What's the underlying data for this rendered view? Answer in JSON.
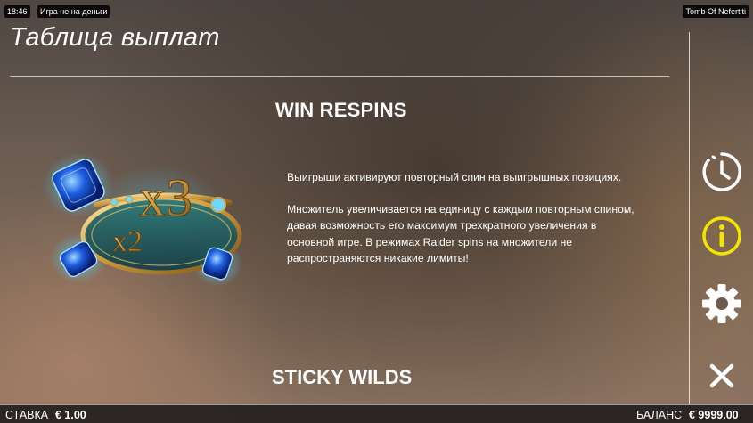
{
  "status_bar": {
    "time": "18:46",
    "mode": "Игра не на деньги",
    "game_title": "Tomb Of Nefertiti"
  },
  "paytable": {
    "title": "Таблица выплат",
    "section": {
      "heading": "WIN RESPINS",
      "symbol_icon": "sapphire-multiplier-icon",
      "multiplier_labels": [
        "x2",
        "x3"
      ],
      "paragraphs": [
        "Выигрыши активируют повторный спин на выигрышных позициях.",
        "Множитель увеличивается на единицу с каждым повторным спином, давая возможность его максимум трехкратного увеличения в основной игре. В режимах Raider spins на множители не распространяются никакие лимиты!"
      ]
    },
    "next_section_heading": "STICKY WILDS"
  },
  "menu": {
    "history_icon": "history-clock-icon",
    "info_icon": "info-icon",
    "settings_icon": "gear-icon",
    "close_icon": "close-icon",
    "info_color": "#f5e400"
  },
  "bottom_bar": {
    "bet_label": "СТАВКА",
    "bet_value": "€ 1.00",
    "balance_label": "БАЛАНС",
    "balance_value": "€ 9999.00"
  }
}
